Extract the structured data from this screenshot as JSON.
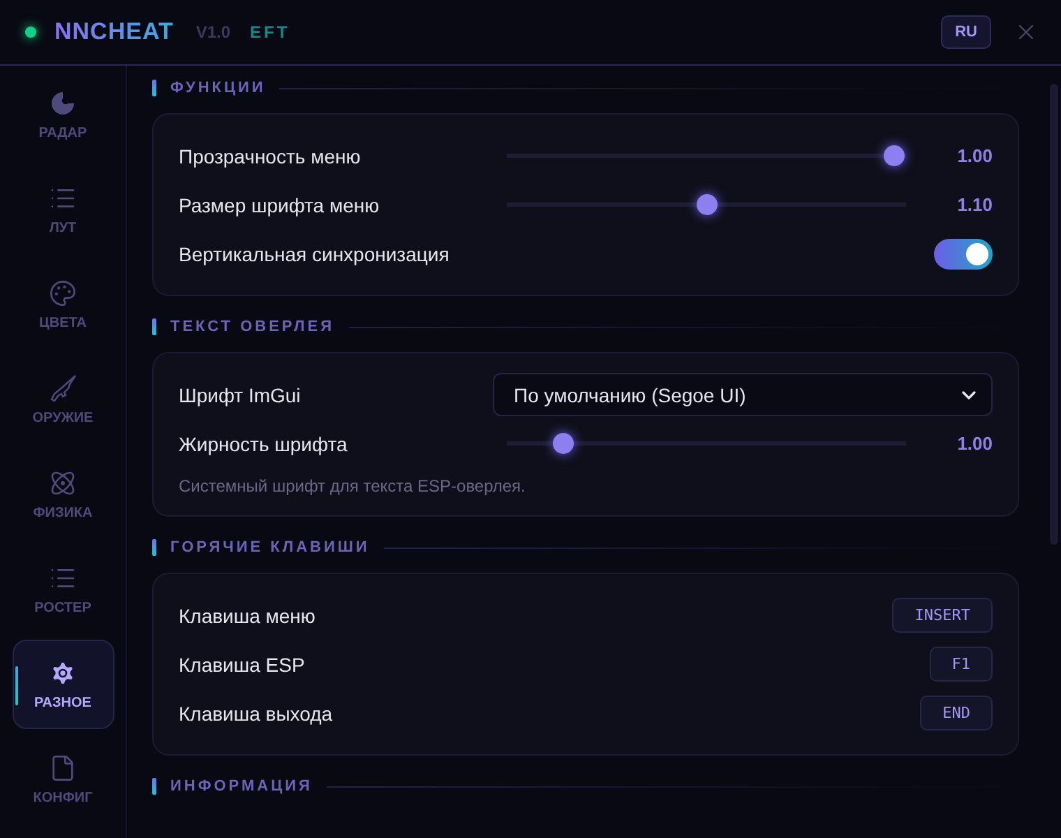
{
  "header": {
    "title": "NNCHEAT",
    "version": "V1.0",
    "tag": "EFT",
    "language_button": "RU"
  },
  "sidebar": {
    "items": [
      {
        "label": "РАДАР",
        "kind": "radar",
        "selected": false
      },
      {
        "label": "ЛУТ",
        "kind": "list",
        "selected": false
      },
      {
        "label": "ЦВЕТА",
        "kind": "palette",
        "selected": false
      },
      {
        "label": "ОРУЖИЕ",
        "kind": "rifle",
        "selected": false
      },
      {
        "label": "ФИЗИКА",
        "kind": "atom",
        "selected": false
      },
      {
        "label": "РОСТЕР",
        "kind": "list",
        "selected": false
      },
      {
        "label": "РАЗНОЕ",
        "kind": "gear",
        "selected": true
      },
      {
        "label": "КОНФИГ",
        "kind": "file",
        "selected": false
      }
    ]
  },
  "sections": [
    {
      "title": "ФУНКЦИИ",
      "rows": [
        {
          "kind": "slider",
          "label": "Прозрачность меню",
          "level": 0.97,
          "reading": "1.00"
        },
        {
          "kind": "slider",
          "label": "Размер шрифта меню",
          "level": 0.5,
          "reading": "1.10"
        },
        {
          "kind": "toggle",
          "label": "Вертикальная синхронизация",
          "on": true
        }
      ]
    },
    {
      "title": "ТЕКСТ ОВЕРЛЕЯ",
      "rows": [
        {
          "kind": "select",
          "label": "Шрифт ImGui",
          "value": "По умолчанию (Segoe UI)"
        },
        {
          "kind": "slider",
          "label": "Жирность шрифта",
          "level": 0.14,
          "reading": "1.00"
        },
        {
          "kind": "note",
          "text": "Системный шрифт для текста ESP-оверлея."
        }
      ]
    },
    {
      "title": "ГОРЯЧИЕ КЛАВИШИ",
      "rows": [
        {
          "kind": "key",
          "label": "Клавиша меню",
          "key": "INSERT"
        },
        {
          "kind": "key",
          "label": "Клавиша ESP",
          "key": "F1"
        },
        {
          "kind": "key",
          "label": "Клавиша выхода",
          "key": "END"
        }
      ]
    },
    {
      "title": "ИНФОРМАЦИЯ"
    }
  ]
}
